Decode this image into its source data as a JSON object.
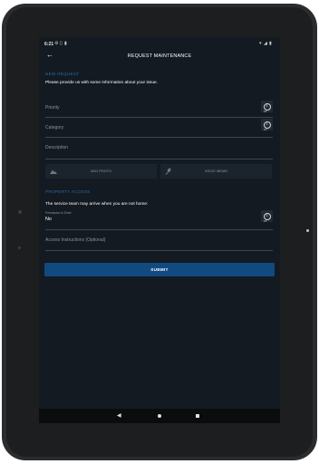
{
  "status_bar": {
    "time": "6:21",
    "icons": [
      "settings-icon",
      "sim-icon",
      "battery-saver-icon",
      "wifi-icon",
      "signal-icon",
      "battery-icon"
    ]
  },
  "app_bar": {
    "title": "REQUEST MAINTENANCE",
    "back_icon": "back-arrow-icon"
  },
  "new_request": {
    "header": "NEW REQUEST",
    "intro": "Please provide us with some information about your issue.",
    "priority": {
      "placeholder": "Priority",
      "info_icon": "info-icon"
    },
    "category": {
      "placeholder": "Category",
      "info_icon": "info-icon"
    },
    "description": {
      "placeholder": "Description"
    },
    "add_photo": {
      "label": "ADD PHOTO",
      "icon": "image-icon"
    },
    "voice_memo": {
      "label": "VOICE MEMO",
      "icon": "microphone-icon"
    }
  },
  "property_access": {
    "header": "PROPERTY ACCESS",
    "notice": "The service team may arrive when you are not home:",
    "permission": {
      "label": "Permission to Enter",
      "value": "No",
      "info_icon": "info-icon"
    },
    "access_instructions": {
      "placeholder": "Access Instructions (Optional)"
    }
  },
  "submit": {
    "label": "SUBMIT"
  },
  "colors": {
    "screen_bg": "#131a21",
    "accent": "#2f69a8",
    "submit_bg": "#114a80",
    "text_primary": "#ffffff",
    "text_secondary": "#8b939c"
  }
}
